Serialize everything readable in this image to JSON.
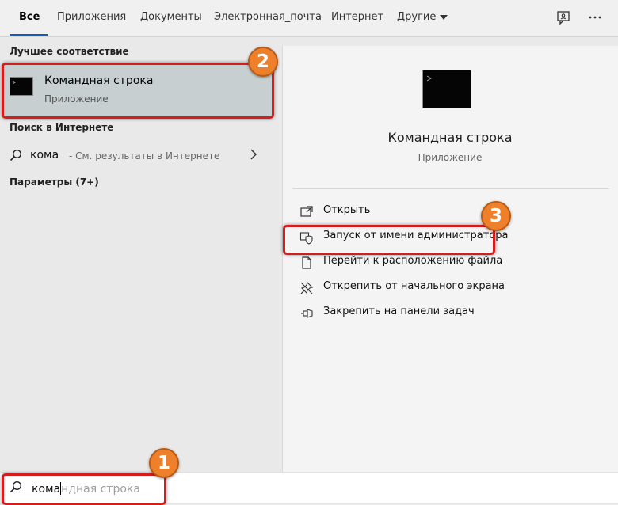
{
  "tabs": [
    {
      "label": "Все"
    },
    {
      "label": "Приложения"
    },
    {
      "label": "Документы"
    },
    {
      "label": "Электронная_почта"
    },
    {
      "label": "Интернет"
    },
    {
      "label": "Другие"
    }
  ],
  "left_pane": {
    "best_match_title": "Лучшее соответствие",
    "best_match_item": {
      "title": "Командная строка",
      "subtitle": "Приложение",
      "icon": "command-prompt-icon"
    },
    "web_search_title": "Поиск в Интернете",
    "web_search_item": {
      "query": "кома",
      "hint": "- См. результаты в Интернете"
    },
    "settings_title": "Параметры (7+)"
  },
  "right_pane": {
    "app_name": "Командная строка",
    "app_type": "Приложение",
    "actions": [
      {
        "label": "Открыть",
        "icon": "open-icon"
      },
      {
        "label": "Запуск от имени администратора",
        "icon": "shield-icon"
      },
      {
        "label": "Перейти к расположению файла",
        "icon": "file-location-icon"
      },
      {
        "label": "Открепить от начального экрана",
        "icon": "unpin-icon"
      },
      {
        "label": "Закрепить на панели задач",
        "icon": "pin-icon"
      }
    ]
  },
  "search_bar": {
    "typed": "кома",
    "completion": "ндная строка"
  },
  "badges": [
    "1",
    "2",
    "3"
  ],
  "colors": {
    "accent": "#0f5fb8",
    "highlight": "#d51d1d",
    "badge": "#ee7f2b"
  }
}
